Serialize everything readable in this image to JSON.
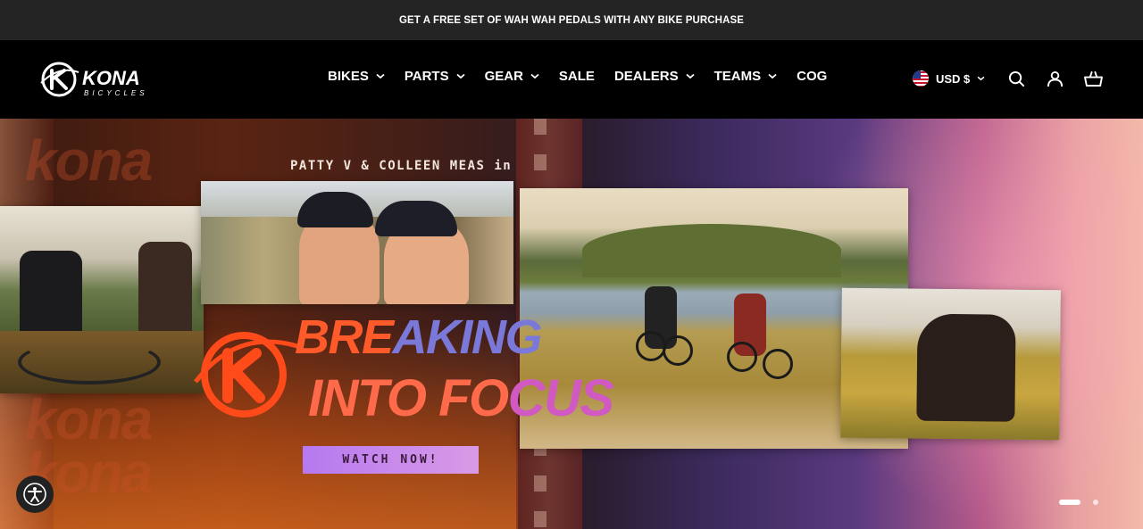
{
  "announcement": {
    "text": "GET A FREE SET OF WAH WAH PEDALS WITH ANY BIKE PURCHASE"
  },
  "brand": {
    "name": "KONA",
    "tagline": "BICYCLES"
  },
  "nav": {
    "items": [
      {
        "label": "BIKES",
        "has_dropdown": true
      },
      {
        "label": "PARTS",
        "has_dropdown": true
      },
      {
        "label": "GEAR",
        "has_dropdown": true
      },
      {
        "label": "SALE",
        "has_dropdown": false
      },
      {
        "label": "DEALERS",
        "has_dropdown": true
      },
      {
        "label": "TEAMS",
        "has_dropdown": true
      },
      {
        "label": "COG",
        "has_dropdown": false
      }
    ]
  },
  "tools": {
    "currency": "USD $",
    "icons": [
      "us-flag-icon",
      "search-icon",
      "account-icon",
      "cart-icon"
    ]
  },
  "hero": {
    "subtitle": "PATTY V & COLLEEN MEAS in",
    "headline_line1_a": "BRE",
    "headline_line1_b": "AKING",
    "headline_line2_a": "INTO FO",
    "headline_line2_b": "CUS",
    "watermark": "kona",
    "cta": "WATCH NOW!",
    "slides_total": 2,
    "active_slide": 1
  },
  "colors": {
    "announcement_bg": "#242424",
    "header_bg": "#000000",
    "headline_orange": "#ff5a2a",
    "headline_purple": "#d15ac2",
    "cta_bg": "#b679f0"
  }
}
